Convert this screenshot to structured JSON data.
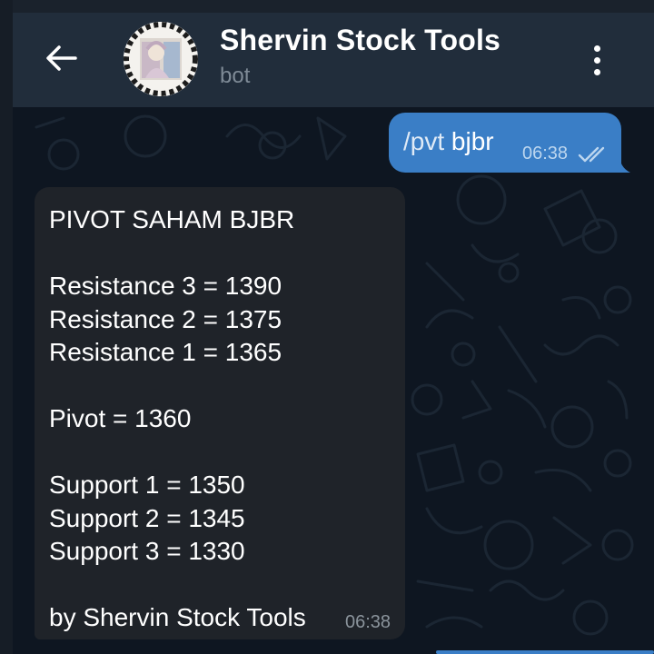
{
  "header": {
    "title": "Shervin Stock Tools",
    "subtitle": "bot"
  },
  "outgoing": {
    "command": "/pvt",
    "argument": "bjbr",
    "time": "06:38",
    "status": "read"
  },
  "incoming": {
    "lines": [
      "PIVOT SAHAM BJBR",
      "",
      "Resistance 3 = 1390",
      "Resistance 2 = 1375",
      "Resistance 1 = 1365",
      "",
      "Pivot = 1360",
      "",
      "Support 1 = 1350",
      "Support 2 = 1345",
      "Support 3 = 1330",
      "",
      "by Shervin Stock Tools"
    ],
    "time": "06:38"
  },
  "colors": {
    "background": "#0e1621",
    "header": "#212d3b",
    "outgoing_bubble": "#3a7ec6",
    "incoming_bubble": "#1f2329"
  },
  "icons": {
    "back": "arrow-left-icon",
    "menu": "more-vertical-icon",
    "ticks": "double-check-icon"
  }
}
